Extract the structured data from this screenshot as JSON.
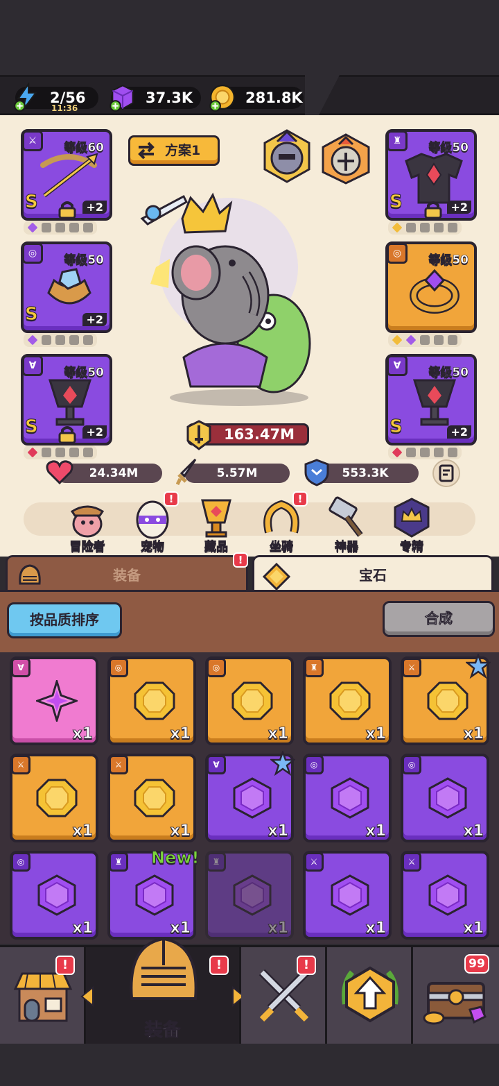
{
  "resources": {
    "energy": "2/56",
    "energy_timer": "11:36",
    "gems": "37.3K",
    "coins": "281.8K"
  },
  "preset": {
    "label": "方案1"
  },
  "left_slots": [
    {
      "level": "等级60",
      "grade": "S",
      "plus": "+2",
      "icon": "sword-icon",
      "item": "crossbow"
    },
    {
      "level": "等级50",
      "grade": "S",
      "plus": "+2",
      "icon": "ring-icon",
      "item": "bracelet"
    },
    {
      "level": "等级50",
      "grade": "S",
      "plus": "+2",
      "icon": "necklace-icon",
      "item": "amulet"
    }
  ],
  "right_slots": [
    {
      "level": "等级50",
      "grade": "S",
      "plus": "+2",
      "icon": "armor-icon",
      "item": "armor"
    },
    {
      "level": "等级50",
      "grade": "",
      "plus": "",
      "icon": "ring-icon",
      "item": "ring"
    },
    {
      "level": "等级50",
      "grade": "S",
      "plus": "+2",
      "icon": "necklace-icon",
      "item": "amulet"
    }
  ],
  "power": "163.47M",
  "stats": {
    "hp": "24.34M",
    "attack": "5.57M",
    "defense": "553.3K"
  },
  "menu": [
    {
      "label": "冒险者",
      "icon": "adventurer-icon"
    },
    {
      "label": "宠物",
      "icon": "pet-egg-icon",
      "badge": "!"
    },
    {
      "label": "藏品",
      "icon": "collection-icon"
    },
    {
      "label": "坐骑",
      "icon": "mount-icon",
      "badge": "!"
    },
    {
      "label": "神器",
      "icon": "artifact-hammer-icon"
    },
    {
      "label": "专精",
      "icon": "mastery-icon"
    }
  ],
  "tabs": {
    "equipment": "装备",
    "gems": "宝石",
    "equipment_badge": "!"
  },
  "buttons": {
    "sort": "按品质排序",
    "merge": "合成"
  },
  "inventory": [
    {
      "rarity": "pink",
      "qty": "x1"
    },
    {
      "rarity": "gold",
      "qty": "x1"
    },
    {
      "rarity": "gold",
      "qty": "x1"
    },
    {
      "rarity": "gold",
      "qty": "x1"
    },
    {
      "rarity": "gold",
      "qty": "x1",
      "star": true
    },
    {
      "rarity": "gold",
      "qty": "x1"
    },
    {
      "rarity": "gold",
      "qty": "x1"
    },
    {
      "rarity": "purple",
      "qty": "x1",
      "star": true
    },
    {
      "rarity": "purple",
      "qty": "x1"
    },
    {
      "rarity": "purple",
      "qty": "x1"
    },
    {
      "rarity": "purple",
      "qty": "x1"
    },
    {
      "rarity": "purple",
      "qty": "x1"
    },
    {
      "rarity": "purple",
      "qty": "x1",
      "dim": true
    },
    {
      "rarity": "purple",
      "qty": "x1"
    },
    {
      "rarity": "purple",
      "qty": "x1"
    }
  ],
  "new_label": "New!",
  "nav": {
    "shop_badge": "!",
    "equip_label": "装备",
    "equip_badge": "!",
    "battle_badge": "!",
    "chest_count": "99"
  },
  "colors": {
    "purple": "#8a4be0",
    "gold": "#f1a53a",
    "pink": "#f07bd0",
    "panel": "#f6ecd9",
    "power": "#9a2f3b"
  }
}
